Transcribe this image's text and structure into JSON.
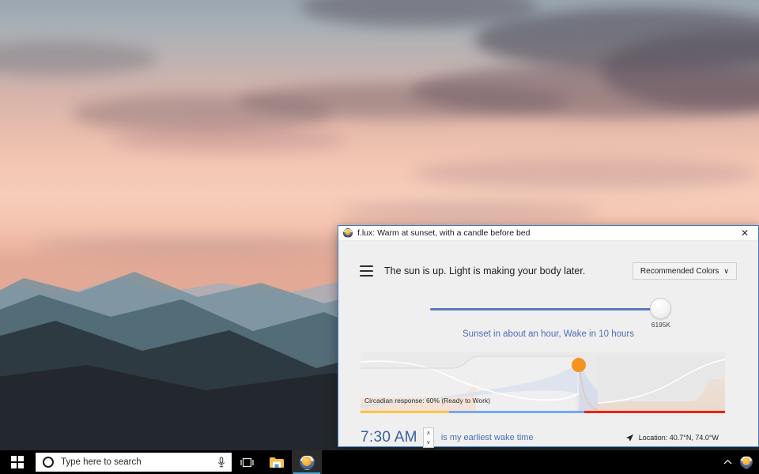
{
  "desktop": {
    "wallpaper_description": "sunset-mountains-photo",
    "wallpaper_colors": {
      "sky_top": "#9aa6b0",
      "sky_glow": "#f6cdb9",
      "cloud_dark": "#5f5660",
      "mountain_far": "#8da0ae",
      "mountain_near": "#2b2f35"
    }
  },
  "taskbar": {
    "start_label": "Start",
    "search": {
      "placeholder": "Type here to search",
      "cortana_icon": "cortana-circle-icon",
      "mic_icon": "microphone-icon"
    },
    "apps": [
      {
        "name": "task-view",
        "icon": "task-view-icon",
        "label": "Task View",
        "active": false
      },
      {
        "name": "file-explorer",
        "icon": "folder-icon",
        "label": "File Explorer",
        "active": false
      },
      {
        "name": "flux",
        "icon": "flux-icon",
        "label": "f.lux",
        "active": true
      }
    ],
    "tray": [
      {
        "name": "show-hidden-icons",
        "icon": "chevron-up-icon",
        "label": "Show hidden icons"
      },
      {
        "name": "flux-tray",
        "icon": "flux-icon",
        "label": "f.lux"
      }
    ]
  },
  "window": {
    "titlebar": {
      "icon": "flux-icon",
      "title": "f.lux: Warm at sunset, with a candle before bed",
      "close_label": "✕"
    },
    "header": {
      "menu_icon": "hamburger-menu-icon",
      "status_message": "The sun is up. Light is making your body later.",
      "preset_dropdown": {
        "value": "Recommended Colors",
        "caret": "∨"
      }
    },
    "slider": {
      "value_label": "6195K",
      "value_kelvin": 6195,
      "min_kelvin": 1900,
      "max_kelvin": 6500,
      "fill_color": "#5b79bd",
      "percent": 93
    },
    "sun_info": "Sunset in about an hour, Wake in 10 hours",
    "chart": {
      "circadian_label": "Circadian response: 60% (Ready to Work)",
      "circadian_percent": 60,
      "marker": {
        "name": "current-time-marker",
        "color": "#f59320",
        "x_percent": 59.8,
        "y_percent": 21
      }
    },
    "bottom": {
      "wake_time": "7:30 AM",
      "wake_label": "is my earliest wake time",
      "spinner_up": "∧",
      "spinner_down": "∨",
      "location_icon": "navigation-arrow-icon",
      "location_text": "Location: 40.7°N, 74.0°W"
    }
  },
  "chart_data": {
    "type": "area",
    "title": "Circadian response and light curve",
    "xlabel": "",
    "ylabel": "",
    "grid": false,
    "legend": null,
    "xlim": [
      0,
      100
    ],
    "ylim": [
      0,
      100
    ],
    "annotations": [
      "Circadian response: 60% (Ready to Work)"
    ],
    "series": [
      {
        "name": "melatonin-curve",
        "color": "#ffffff",
        "x": [
          0,
          8,
          16,
          24,
          32,
          40,
          48,
          56,
          64,
          72,
          80,
          88,
          96,
          100
        ],
        "values": [
          86,
          88,
          84,
          72,
          56,
          44,
          36,
          32,
          33,
          40,
          52,
          66,
          78,
          82
        ]
      },
      {
        "name": "alertness-band",
        "color": "#dde2ee",
        "x": [
          0,
          12,
          24,
          36,
          48,
          58,
          60,
          62,
          75,
          88,
          100
        ],
        "values": [
          12,
          18,
          26,
          36,
          46,
          58,
          58,
          10,
          8,
          7,
          6
        ]
      },
      {
        "name": "screen-color-step",
        "color": "#f2f2f2",
        "x": [
          0,
          30,
          32,
          59,
          61,
          100
        ],
        "values": [
          72,
          72,
          94,
          94,
          18,
          18
        ]
      },
      {
        "name": "warm-light-base",
        "color": "#f6d9c2",
        "x": [
          0,
          28,
          32,
          59,
          62,
          92,
          96,
          100
        ],
        "values": [
          22,
          22,
          4,
          4,
          20,
          20,
          26,
          26
        ]
      }
    ],
    "phase_bar": {
      "segments": [
        {
          "name": "night-warm",
          "color": "#f7c545",
          "start_percent": 0,
          "end_percent": 24.3
        },
        {
          "name": "day-cool",
          "color": "#74a9f0",
          "start_percent": 24.3,
          "end_percent": 61.4
        },
        {
          "name": "evening-warm",
          "color": "#ee2211",
          "start_percent": 61.4,
          "end_percent": 100
        }
      ]
    }
  }
}
